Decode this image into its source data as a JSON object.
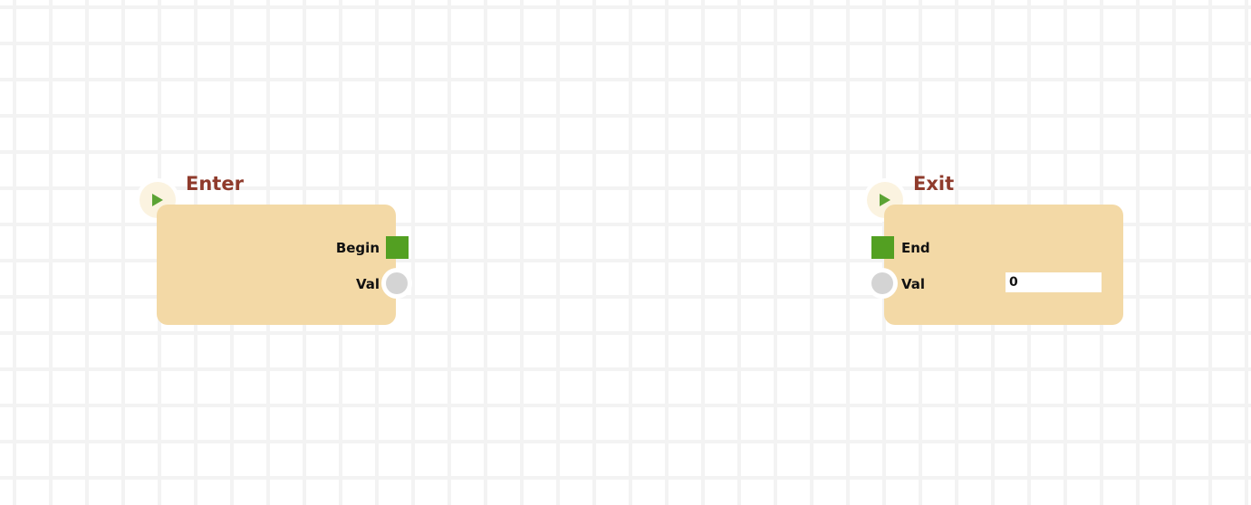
{
  "colors": {
    "title": "#8f3b2c",
    "body": "#f3d9a6",
    "exec_arrow": "#5ba334",
    "flow_pin": "#53a022",
    "data_pin": "#d4d4d4"
  },
  "nodes": {
    "enter": {
      "title": "Enter",
      "exec_icon": "play-icon",
      "outputs": {
        "flow_label": "Begin",
        "value_label": "Val"
      }
    },
    "exit": {
      "title": "Exit",
      "exec_icon": "play-icon",
      "inputs": {
        "flow_label": "End",
        "value_label": "Val",
        "value": "0"
      }
    }
  }
}
